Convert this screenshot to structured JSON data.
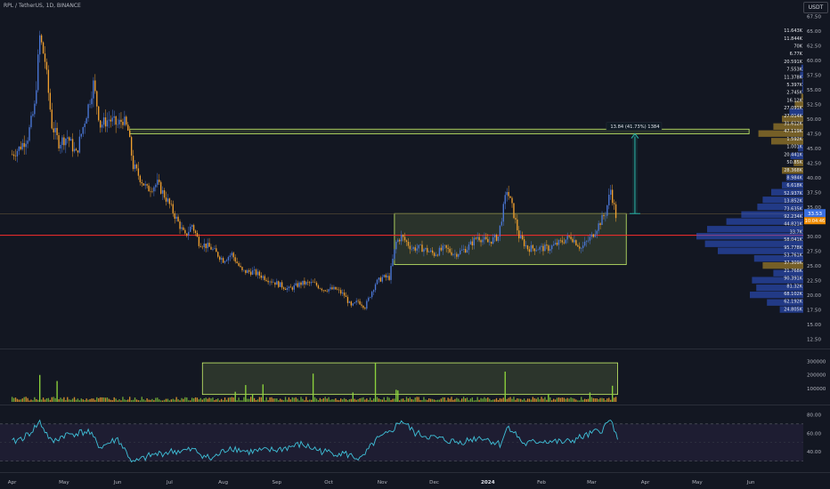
{
  "header": {
    "symbol_line": "RPL / TetherUS, 1D, BINANCE",
    "currency_button": "USDT"
  },
  "colors": {
    "background": "#131722",
    "up": "#4b78d8",
    "down": "#f0a02f",
    "grid": "#1e222d",
    "support_line": "#ff2d2d",
    "box": "#c9f26a",
    "rsi_line": "#3fc1d9",
    "profile_blue": "#2f58d8",
    "profile_gold": "#c79b2b",
    "current_label": "#3a6fe0",
    "countdown_label": "#f08c00"
  },
  "chart_data": [
    {
      "type": "candlestick",
      "title": "RPL / TetherUS, 1D, BINANCE",
      "x_ticks": [
        "Apr",
        "May",
        "Jun",
        "Jul",
        "Aug",
        "Sep",
        "Oct",
        "Nov",
        "Dec",
        "2024",
        "Feb",
        "Mar",
        "Apr",
        "May",
        "Jun"
      ],
      "y_ticks": [
        "67.50",
        "65.00",
        "62.50",
        "60.00",
        "57.50",
        "55.00",
        "52.50",
        "50.00",
        "47.50",
        "45.00",
        "42.50",
        "40.00",
        "37.50",
        "35.00",
        "32.50",
        "30.00",
        "27.50",
        "25.00",
        "22.50",
        "20.00",
        "17.50",
        "15.00",
        "12.50"
      ],
      "ylim": [
        11.5,
        68.5
      ],
      "price_path": [
        [
          "2023-04-01",
          44
        ],
        [
          "2023-04-05",
          45
        ],
        [
          "2023-04-10",
          47
        ],
        [
          "2023-04-14",
          52
        ],
        [
          "2023-04-17",
          64
        ],
        [
          "2023-04-20",
          60
        ],
        [
          "2023-04-24",
          49
        ],
        [
          "2023-04-28",
          46
        ],
        [
          "2023-05-03",
          47
        ],
        [
          "2023-05-08",
          44
        ],
        [
          "2023-05-14",
          51
        ],
        [
          "2023-05-18",
          56
        ],
        [
          "2023-05-22",
          49
        ],
        [
          "2023-05-27",
          50
        ],
        [
          "2023-06-01",
          49
        ],
        [
          "2023-06-04",
          50
        ],
        [
          "2023-06-07",
          48
        ],
        [
          "2023-06-10",
          42
        ],
        [
          "2023-06-14",
          40
        ],
        [
          "2023-06-18",
          38
        ],
        [
          "2023-06-24",
          39
        ],
        [
          "2023-06-30",
          36
        ],
        [
          "2023-07-05",
          33
        ],
        [
          "2023-07-10",
          30
        ],
        [
          "2023-07-14",
          32
        ],
        [
          "2023-07-18",
          29
        ],
        [
          "2023-07-25",
          28
        ],
        [
          "2023-08-01",
          26
        ],
        [
          "2023-08-06",
          27
        ],
        [
          "2023-08-12",
          24
        ],
        [
          "2023-08-18",
          24
        ],
        [
          "2023-08-25",
          23
        ],
        [
          "2023-09-01",
          22
        ],
        [
          "2023-09-08",
          21
        ],
        [
          "2023-09-15",
          22
        ],
        [
          "2023-09-22",
          22
        ],
        [
          "2023-09-28",
          21
        ],
        [
          "2023-10-05",
          21
        ],
        [
          "2023-10-10",
          20
        ],
        [
          "2023-10-14",
          18
        ],
        [
          "2023-10-18",
          19
        ],
        [
          "2023-10-22",
          18
        ],
        [
          "2023-10-25",
          20
        ],
        [
          "2023-10-28",
          22
        ],
        [
          "2023-11-01",
          23
        ],
        [
          "2023-11-05",
          23
        ],
        [
          "2023-11-09",
          29
        ],
        [
          "2023-11-12",
          30
        ],
        [
          "2023-11-18",
          28
        ],
        [
          "2023-11-24",
          28
        ],
        [
          "2023-12-01",
          27
        ],
        [
          "2023-12-07",
          28
        ],
        [
          "2023-12-13",
          27
        ],
        [
          "2023-12-20",
          28
        ],
        [
          "2023-12-26",
          30
        ],
        [
          "2024-01-01",
          29
        ],
        [
          "2024-01-07",
          30
        ],
        [
          "2024-01-12",
          38
        ],
        [
          "2024-01-15",
          35
        ],
        [
          "2024-01-19",
          30
        ],
        [
          "2024-01-24",
          28
        ],
        [
          "2024-01-30",
          28
        ],
        [
          "2024-02-05",
          28
        ],
        [
          "2024-02-12",
          29
        ],
        [
          "2024-02-18",
          30
        ],
        [
          "2024-02-24",
          28
        ],
        [
          "2024-03-01",
          30
        ],
        [
          "2024-03-05",
          32
        ],
        [
          "2024-03-09",
          34
        ],
        [
          "2024-03-12",
          38
        ],
        [
          "2024-03-15",
          33.53
        ]
      ],
      "annotations": {
        "support_price": 30.2,
        "range_box": {
          "from": "2023-11-08",
          "to": "2024-03-21",
          "low": 25.2,
          "high": 33.9
        },
        "upper_line": {
          "from": "2023-06-08",
          "to": "2024-05-31",
          "low": 47.5,
          "high": 48.3
        },
        "current_price_line": 33.9,
        "measure_arrow": {
          "at": "2024-03-26",
          "from": 33.9,
          "to": 47.5
        },
        "measure_label": "13.84 (41.73%) 1384"
      },
      "current_price_label": "33.53",
      "countdown_label": "10:04:46",
      "volume_profile": {
        "labels": [
          "11.643K",
          "11.844K",
          "70K",
          "6.77K",
          "20.591K",
          "7.553K",
          "11.378K",
          "5.397K",
          "2.745K",
          "16.12K",
          "27.091K",
          "27.014K",
          "31.612K",
          "47.119K",
          "1.592K",
          "1.001K",
          "20.441K",
          "50.85K",
          "28.368K",
          "8.984K",
          "6.618K",
          "52.937K",
          "13.852K",
          "73.635K",
          "92.234K",
          "44.821K",
          "33.7K",
          "58.041K",
          "95.778K",
          "53.761K",
          "37.309K",
          "21.768K",
          "90.391K",
          "81.32K",
          "68.102K",
          "62.192K",
          "24.805K"
        ],
        "rows": [
          {
            "price": 65.0,
            "width": 0.0,
            "color": "blue"
          },
          {
            "price": 63.7,
            "width": 0.0,
            "color": "blue"
          },
          {
            "price": 62.5,
            "width": 0.0,
            "color": "blue"
          },
          {
            "price": 61.2,
            "width": 0.0,
            "color": "blue"
          },
          {
            "price": 60.0,
            "width": 0.0,
            "color": "blue"
          },
          {
            "price": 58.7,
            "width": 0.02,
            "color": "blue"
          },
          {
            "price": 57.5,
            "width": 0.03,
            "color": "blue"
          },
          {
            "price": 56.2,
            "width": 0.01,
            "color": "blue"
          },
          {
            "price": 55.0,
            "width": 0.01,
            "color": "blue"
          },
          {
            "price": 53.7,
            "width": 0.02,
            "color": "gold"
          },
          {
            "price": 52.5,
            "width": 0.08,
            "color": "gold"
          },
          {
            "price": 51.2,
            "width": 0.13,
            "color": "blue"
          },
          {
            "price": 50.0,
            "width": 0.2,
            "color": "gold"
          },
          {
            "price": 48.7,
            "width": 0.28,
            "color": "gold"
          },
          {
            "price": 47.5,
            "width": 0.42,
            "color": "gold"
          },
          {
            "price": 46.2,
            "width": 0.3,
            "color": "gold"
          },
          {
            "price": 45.0,
            "width": 0.05,
            "color": "blue"
          },
          {
            "price": 43.7,
            "width": 0.12,
            "color": "blue"
          },
          {
            "price": 42.5,
            "width": 0.09,
            "color": "gold"
          },
          {
            "price": 41.2,
            "width": 0.2,
            "color": "gold"
          },
          {
            "price": 40.0,
            "width": 0.16,
            "color": "blue"
          },
          {
            "price": 38.7,
            "width": 0.2,
            "color": "blue"
          },
          {
            "price": 37.5,
            "width": 0.3,
            "color": "blue"
          },
          {
            "price": 36.2,
            "width": 0.38,
            "color": "blue"
          },
          {
            "price": 35.0,
            "width": 0.43,
            "color": "blue"
          },
          {
            "price": 33.7,
            "width": 0.58,
            "color": "blue"
          },
          {
            "price": 32.5,
            "width": 0.72,
            "color": "blue"
          },
          {
            "price": 31.2,
            "width": 0.9,
            "color": "blue"
          },
          {
            "price": 30.0,
            "width": 1.0,
            "color": "blue"
          },
          {
            "price": 28.7,
            "width": 0.92,
            "color": "blue"
          },
          {
            "price": 27.5,
            "width": 0.8,
            "color": "blue"
          },
          {
            "price": 26.2,
            "width": 0.46,
            "color": "blue"
          },
          {
            "price": 25.0,
            "width": 0.38,
            "color": "gold"
          },
          {
            "price": 23.7,
            "width": 0.28,
            "color": "blue"
          },
          {
            "price": 22.5,
            "width": 0.48,
            "color": "blue"
          },
          {
            "price": 21.2,
            "width": 0.44,
            "color": "blue"
          },
          {
            "price": 20.0,
            "width": 0.5,
            "color": "blue"
          },
          {
            "price": 18.7,
            "width": 0.34,
            "color": "blue"
          },
          {
            "price": 17.5,
            "width": 0.22,
            "color": "blue"
          }
        ]
      }
    },
    {
      "type": "bar",
      "title": "",
      "y_ticks": [
        "300000",
        "200000",
        "100000"
      ],
      "ylim": [
        0,
        370000
      ],
      "spikes": [
        [
          "2023-04-17",
          200000
        ],
        [
          "2023-04-27",
          155000
        ],
        [
          "2023-08-08",
          75000
        ],
        [
          "2023-08-14",
          125000
        ],
        [
          "2023-08-18",
          60000
        ],
        [
          "2023-08-24",
          130000
        ],
        [
          "2023-09-22",
          210000
        ],
        [
          "2023-10-15",
          70000
        ],
        [
          "2023-10-28",
          290000
        ],
        [
          "2023-11-09",
          90000
        ],
        [
          "2023-11-10",
          85000
        ],
        [
          "2024-01-11",
          225000
        ],
        [
          "2024-02-05",
          60000
        ],
        [
          "2024-02-29",
          70000
        ],
        [
          "2024-03-13",
          120000
        ]
      ],
      "range_box": {
        "from": "2023-07-20",
        "to": "2024-03-16",
        "low": 55000,
        "high": 290000
      }
    },
    {
      "type": "line",
      "title": "",
      "y_ticks": [
        "80.00",
        "60.00",
        "40.00"
      ],
      "ylim": [
        22,
        88
      ],
      "band": [
        30,
        70
      ],
      "rsi": [
        [
          "2023-04-01",
          50
        ],
        [
          "2023-04-10",
          58
        ],
        [
          "2023-04-17",
          72
        ],
        [
          "2023-04-24",
          50
        ],
        [
          "2023-05-01",
          58
        ],
        [
          "2023-05-15",
          62
        ],
        [
          "2023-05-22",
          45
        ],
        [
          "2023-06-01",
          54
        ],
        [
          "2023-06-10",
          28
        ],
        [
          "2023-06-20",
          36
        ],
        [
          "2023-07-01",
          40
        ],
        [
          "2023-07-15",
          42
        ],
        [
          "2023-07-25",
          32
        ],
        [
          "2023-08-05",
          45
        ],
        [
          "2023-08-15",
          40
        ],
        [
          "2023-09-01",
          42
        ],
        [
          "2023-09-15",
          48
        ],
        [
          "2023-09-28",
          40
        ],
        [
          "2023-10-10",
          38
        ],
        [
          "2023-10-20",
          32
        ],
        [
          "2023-10-28",
          52
        ],
        [
          "2023-11-05",
          60
        ],
        [
          "2023-11-12",
          74
        ],
        [
          "2023-11-20",
          60
        ],
        [
          "2023-12-01",
          55
        ],
        [
          "2023-12-15",
          50
        ],
        [
          "2023-12-28",
          56
        ],
        [
          "2024-01-08",
          48
        ],
        [
          "2024-01-13",
          68
        ],
        [
          "2024-01-22",
          48
        ],
        [
          "2024-02-01",
          52
        ],
        [
          "2024-02-15",
          50
        ],
        [
          "2024-02-28",
          58
        ],
        [
          "2024-03-07",
          64
        ],
        [
          "2024-03-11",
          72
        ],
        [
          "2024-03-13",
          74
        ],
        [
          "2024-03-16",
          50
        ]
      ]
    }
  ]
}
